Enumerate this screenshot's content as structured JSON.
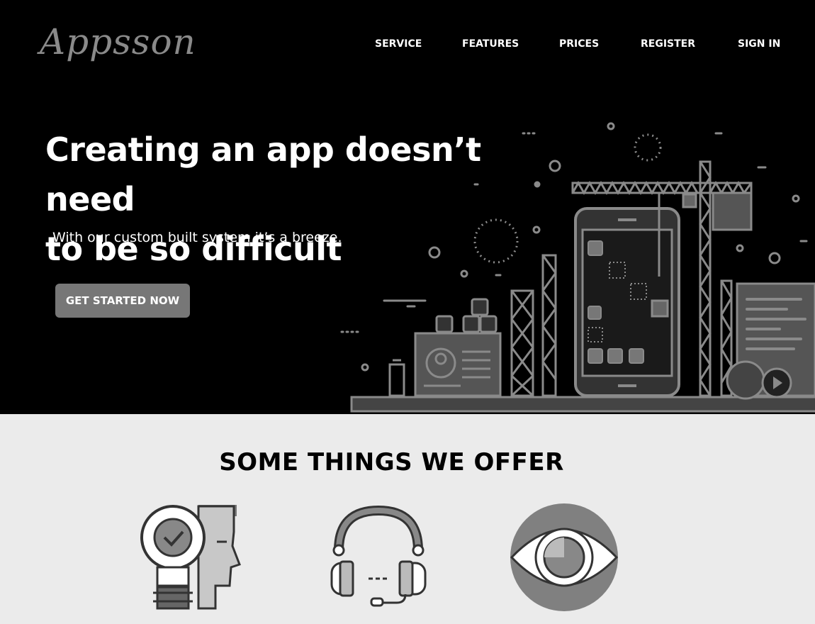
{
  "brand": {
    "logo_text": "Appsson"
  },
  "nav": {
    "items": [
      {
        "label": "SERVICE"
      },
      {
        "label": "FEATURES"
      },
      {
        "label": "PRICES"
      },
      {
        "label": "REGISTER"
      },
      {
        "label": "SIGN IN"
      }
    ]
  },
  "hero": {
    "headline_line1": "Creating an app doesn’t need",
    "headline_line2": "to be so difficult",
    "subline": "With our custom built system it’s a breeze.",
    "cta_label": "GET STARTED NOW"
  },
  "offer": {
    "title": "SOME THINGS WE OFFER",
    "icons": [
      "lightbulb-head-icon",
      "headset-icon",
      "eye-icon"
    ]
  },
  "colors": {
    "hero_bg": "#000000",
    "offer_bg": "#ebebeb",
    "button_bg": "#777777",
    "illustration_gray": "#8a8a8a"
  }
}
